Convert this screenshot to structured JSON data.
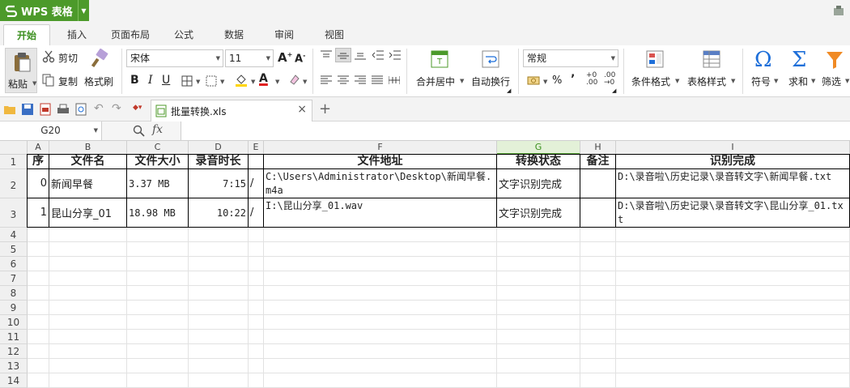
{
  "app": {
    "name": "WPS 表格"
  },
  "tabs": [
    "开始",
    "插入",
    "页面布局",
    "公式",
    "数据",
    "审阅",
    "视图"
  ],
  "ribbon": {
    "paste": "粘贴",
    "cut": "剪切",
    "copy": "复制",
    "format_painter": "格式刷",
    "font_name": "宋体",
    "font_size": "11",
    "merge_center": "合并居中",
    "auto_wrap": "自动换行",
    "number_format": "常规",
    "percent": "%",
    "comma": "’",
    "cond_format": "条件格式",
    "table_style": "表格样式",
    "symbol": "符号",
    "sum": "求和",
    "filter": "筛选"
  },
  "document": {
    "name": "批量转换.xls"
  },
  "formula_bar": {
    "cell_ref": "G20"
  },
  "columns": [
    "A",
    "B",
    "C",
    "D",
    "E",
    "F",
    "G",
    "H",
    "I"
  ],
  "selected_column": "G",
  "rows": [
    "1",
    "2",
    "3",
    "4",
    "5",
    "6",
    "7",
    "8",
    "9",
    "10",
    "11",
    "12",
    "13",
    "14"
  ],
  "table": {
    "headers": [
      "序",
      "文件名",
      "文件大小",
      "录音时长",
      "",
      "文件地址",
      "转换状态",
      "备注",
      "识别完成"
    ],
    "data": [
      [
        "0",
        "新闻早餐",
        "3.37 MB",
        "7:15",
        "/",
        "C:\\Users\\Administrator\\Desktop\\新闻早餐.m4a",
        "文字识别完成",
        "",
        "D:\\录音啦\\历史记录\\录音转文字\\新闻早餐.txt"
      ],
      [
        "1",
        "昆山分享_01",
        "18.98 MB",
        "10:22",
        "/",
        "I:\\昆山分享_01.wav",
        "文字识别完成",
        "",
        "D:\\录音啦\\历史记录\\录音转文字\\昆山分享_01.txt"
      ]
    ]
  },
  "colors": {
    "accent": "#4c9a2a",
    "selected_col": "#5aa53a",
    "icon_blue": "#1e6fd9"
  }
}
